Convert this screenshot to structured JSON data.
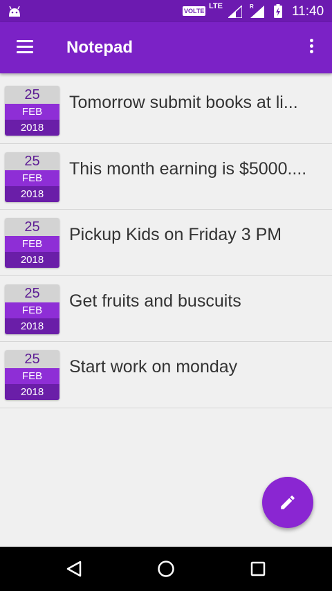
{
  "status_bar": {
    "volte": "VOLTE",
    "network": "LTE",
    "roaming": "R",
    "time": "11:40"
  },
  "app_bar": {
    "title": "Notepad",
    "menu_icon": "hamburger-menu-icon",
    "overflow_icon": "more-vert-icon"
  },
  "notes": [
    {
      "day": "25",
      "month": "FEB",
      "year": "2018",
      "text": "Tomorrow submit books at li..."
    },
    {
      "day": "25",
      "month": "FEB",
      "year": "2018",
      "text": "This month earning is $5000...."
    },
    {
      "day": "25",
      "month": "FEB",
      "year": "2018",
      "text": "Pickup Kids on Friday 3 PM"
    },
    {
      "day": "25",
      "month": "FEB",
      "year": "2018",
      "text": "Get fruits and buscuits"
    },
    {
      "day": "25",
      "month": "FEB",
      "year": "2018",
      "text": "Start work on monday"
    }
  ],
  "fab": {
    "icon": "edit-pencil-icon"
  },
  "nav_bar": {
    "back_icon": "back-icon",
    "home_icon": "home-icon",
    "recents_icon": "recents-icon"
  },
  "colors": {
    "status_bar": "#6c1ab0",
    "app_bar": "#7b22c6",
    "accent": "#8a26d2",
    "background": "#f0f0f0"
  }
}
